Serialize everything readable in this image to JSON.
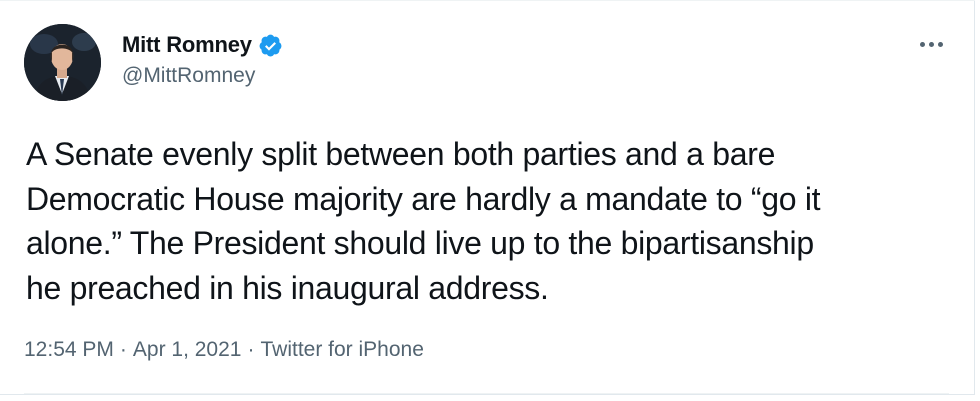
{
  "tweet": {
    "author": {
      "name": "Mitt Romney",
      "handle": "@MittRomney",
      "verified": true,
      "avatar_icon": "profile-photo-icon"
    },
    "text_lines": [
      "A Senate evenly split between both parties and a bare",
      "Democratic House majority are hardly a mandate to “go it",
      "alone.” The President should live up to the bipartisanship",
      "he preached in his inaugural address."
    ],
    "meta": {
      "time": "12:54 PM",
      "separator": "·",
      "date": "Apr 1, 2021",
      "source": "Twitter for iPhone"
    },
    "more_icon": "ellipsis-icon"
  },
  "colors": {
    "text_primary": "#0f1419",
    "text_secondary": "#536471",
    "verified_blue": "#1d9bf0",
    "divider": "#eff3f4"
  }
}
